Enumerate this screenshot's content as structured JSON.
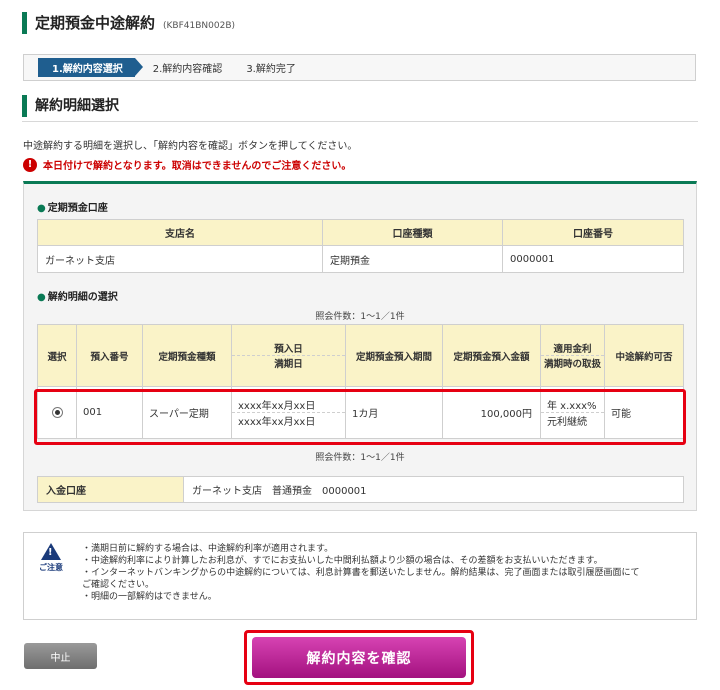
{
  "page": {
    "title": "定期預金中途解約",
    "code": "(KBF41BN002B)"
  },
  "steps": [
    "1.解約内容選択",
    "2.解約内容確認",
    "3.解約完了"
  ],
  "section": {
    "title": "解約明細選択",
    "instruction": "中途解約する明細を選択し、「解約内容を確認」ボタンを押してください。",
    "warning": "本日付けで解約となります。取消はできませんのでご注意ください。"
  },
  "account": {
    "heading": "定期預金口座",
    "headers": [
      "支店名",
      "口座種類",
      "口座番号"
    ],
    "row": [
      "ガーネット支店",
      "定期預金",
      "0000001"
    ]
  },
  "detail": {
    "heading": "解約明細の選択",
    "count_label": "照会件数：1〜1／1件",
    "headers": {
      "select": "選択",
      "deposit_no": "預入番号",
      "type": "定期預金種類",
      "deposit_date": "預入日",
      "maturity_date": "満期日",
      "period": "定期預金預入期間",
      "amount": "定期預金預入金額",
      "rate": "適用金利",
      "maturity_handling": "満期時の取扱",
      "cancel_ok": "中途解約可否"
    },
    "row": {
      "selected": true,
      "deposit_no": "001",
      "type": "スーパー定期",
      "deposit_date": "xxxx年xx月xx日",
      "maturity_date": "xxxx年xx月xx日",
      "period": "1カ月",
      "amount": "100,000円",
      "rate": "年 x.xxx%",
      "maturity_handling": "元利継続",
      "cancel_ok": "可能"
    }
  },
  "deposit_account": {
    "label": "入金口座",
    "value": "ガーネット支店　普通預金　0000001"
  },
  "notice": {
    "icon_label": "ご注意",
    "items": [
      "・満期日前に解約する場合は、中途解約利率が適用されます。",
      "・中途解約利率により計算したお利息が、すでにお支払いした中間利払額より少額の場合は、その差額をお支払いいただきます。",
      "・インターネットバンキングからの中途解約については、利息計算書を郵送いたしません。解約結果は、完了画面または取引履歴画面にて",
      "ご確認ください。",
      "・明細の一部解約はできません。"
    ]
  },
  "buttons": {
    "cancel": "中止",
    "confirm": "解約内容を確認"
  },
  "colors": {
    "accent_green": "#0a7a55",
    "step_blue": "#1f5e8f",
    "warning_red": "#cc0000",
    "highlight_red": "#e60012",
    "confirm_magenta": "#b8198f",
    "header_yellow": "#faf3c8"
  }
}
